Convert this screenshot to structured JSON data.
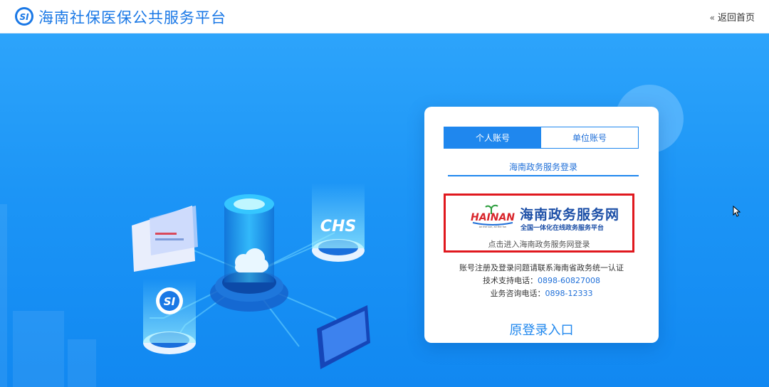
{
  "header": {
    "title": "海南社保医保公共服务平台",
    "back_home": "返回首页"
  },
  "login_card": {
    "tabs": [
      {
        "label": "个人账号",
        "active": true
      },
      {
        "label": "单位账号",
        "active": false
      }
    ],
    "gov_login_label": "海南政务服务登录",
    "gov_platform": {
      "logo_text": "HAINAN",
      "logo_slogan": "All the sun, all the fun",
      "name": "海南政务服务网",
      "subtitle": "全国一体化在线政务服务平台",
      "link_text": "点击进入海南政务服务网登录"
    },
    "notice": "账号注册及登录问题请联系海南省政务统一认证",
    "tech_support_label": "技术支持电话：",
    "tech_support_phone": "0898-60827008",
    "business_label": "业务咨询电话：",
    "business_phone": "0898-12333",
    "original_login": "原登录入口"
  },
  "illustration": {
    "chs_label": "CHS",
    "si_label": "SI"
  },
  "colors": {
    "brand_blue": "#1f87ee",
    "hero_bg": "#1c95f6",
    "highlight_red": "#e0181e"
  }
}
